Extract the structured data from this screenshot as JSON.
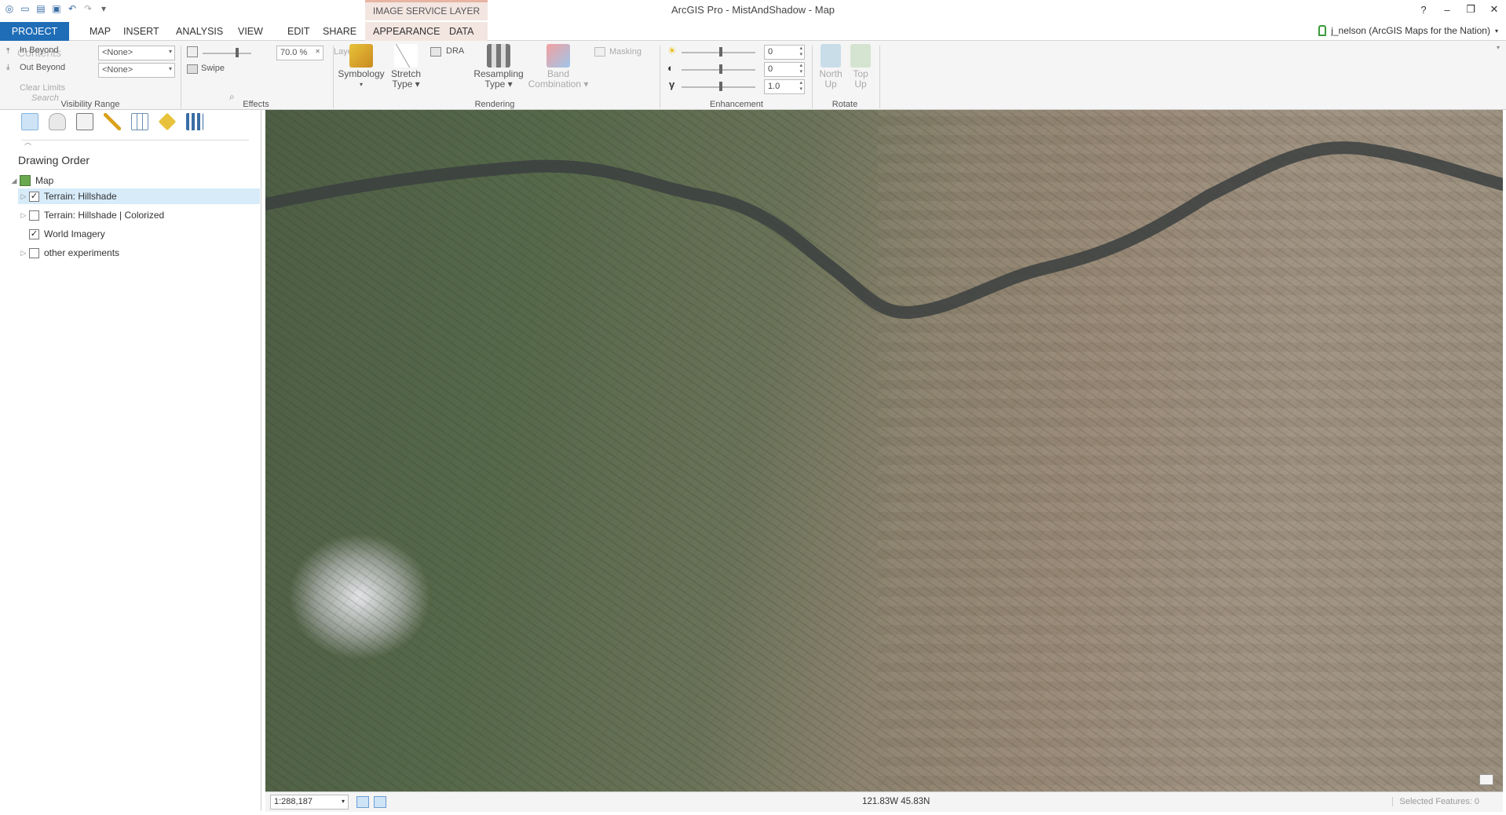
{
  "app": {
    "title": "ArcGIS Pro - MistAndShadow - Map",
    "context_tab_header": "IMAGE SERVICE LAYER",
    "user": "j_nelson (ArcGIS Maps for the Nation)"
  },
  "window": {
    "help": "?",
    "minimize": "–",
    "restore": "❐",
    "close": "✕"
  },
  "tabs": [
    "PROJECT",
    "MAP",
    "INSERT",
    "ANALYSIS",
    "VIEW",
    "EDIT",
    "SHARE",
    "APPEARANCE",
    "DATA"
  ],
  "ribbon": {
    "visibility": {
      "in_beyond": "In Beyond",
      "out_beyond": "Out Beyond",
      "in_value": "<None>",
      "out_value": "<None>",
      "clear_limits": "Clear Limits",
      "group_label": "Visibility Range",
      "contents_ghost": "Contents"
    },
    "effects": {
      "transparency": "70.0 %",
      "layer_blend": "Layers",
      "swipe": "Swipe",
      "group_label": "Effects"
    },
    "rendering": {
      "symbology": "Symbology",
      "stretch_type": [
        "Stretch",
        "Type"
      ],
      "dra": "DRA",
      "resampling_type": [
        "Resampling",
        "Type"
      ],
      "band_combination": [
        "Band",
        "Combination"
      ],
      "masking": "Masking",
      "group_label": "Rendering"
    },
    "enhancement": {
      "brightness": "0",
      "contrast": "0",
      "gamma": "1.0",
      "group_label": "Enhancement"
    },
    "rotate": {
      "north_up": [
        "North",
        "Up"
      ],
      "top_up": [
        "Top",
        "Up"
      ],
      "group_label": "Rotate"
    }
  },
  "contents": {
    "search_placeholder": "Search",
    "section_title": "Drawing Order",
    "map_label": "Map",
    "layers": [
      {
        "name": "Terrain: Hillshade",
        "checked": true,
        "selected": true
      },
      {
        "name": "Terrain: Hillshade | Colorized",
        "checked": false,
        "selected": false
      },
      {
        "name": "World Imagery",
        "checked": true,
        "selected": false
      },
      {
        "name": "other experiments",
        "checked": false,
        "selected": false
      }
    ]
  },
  "status": {
    "scale": "1:288,187",
    "coordinates": "121.83W 45.83N",
    "selected_features": "Selected Features: 0"
  }
}
